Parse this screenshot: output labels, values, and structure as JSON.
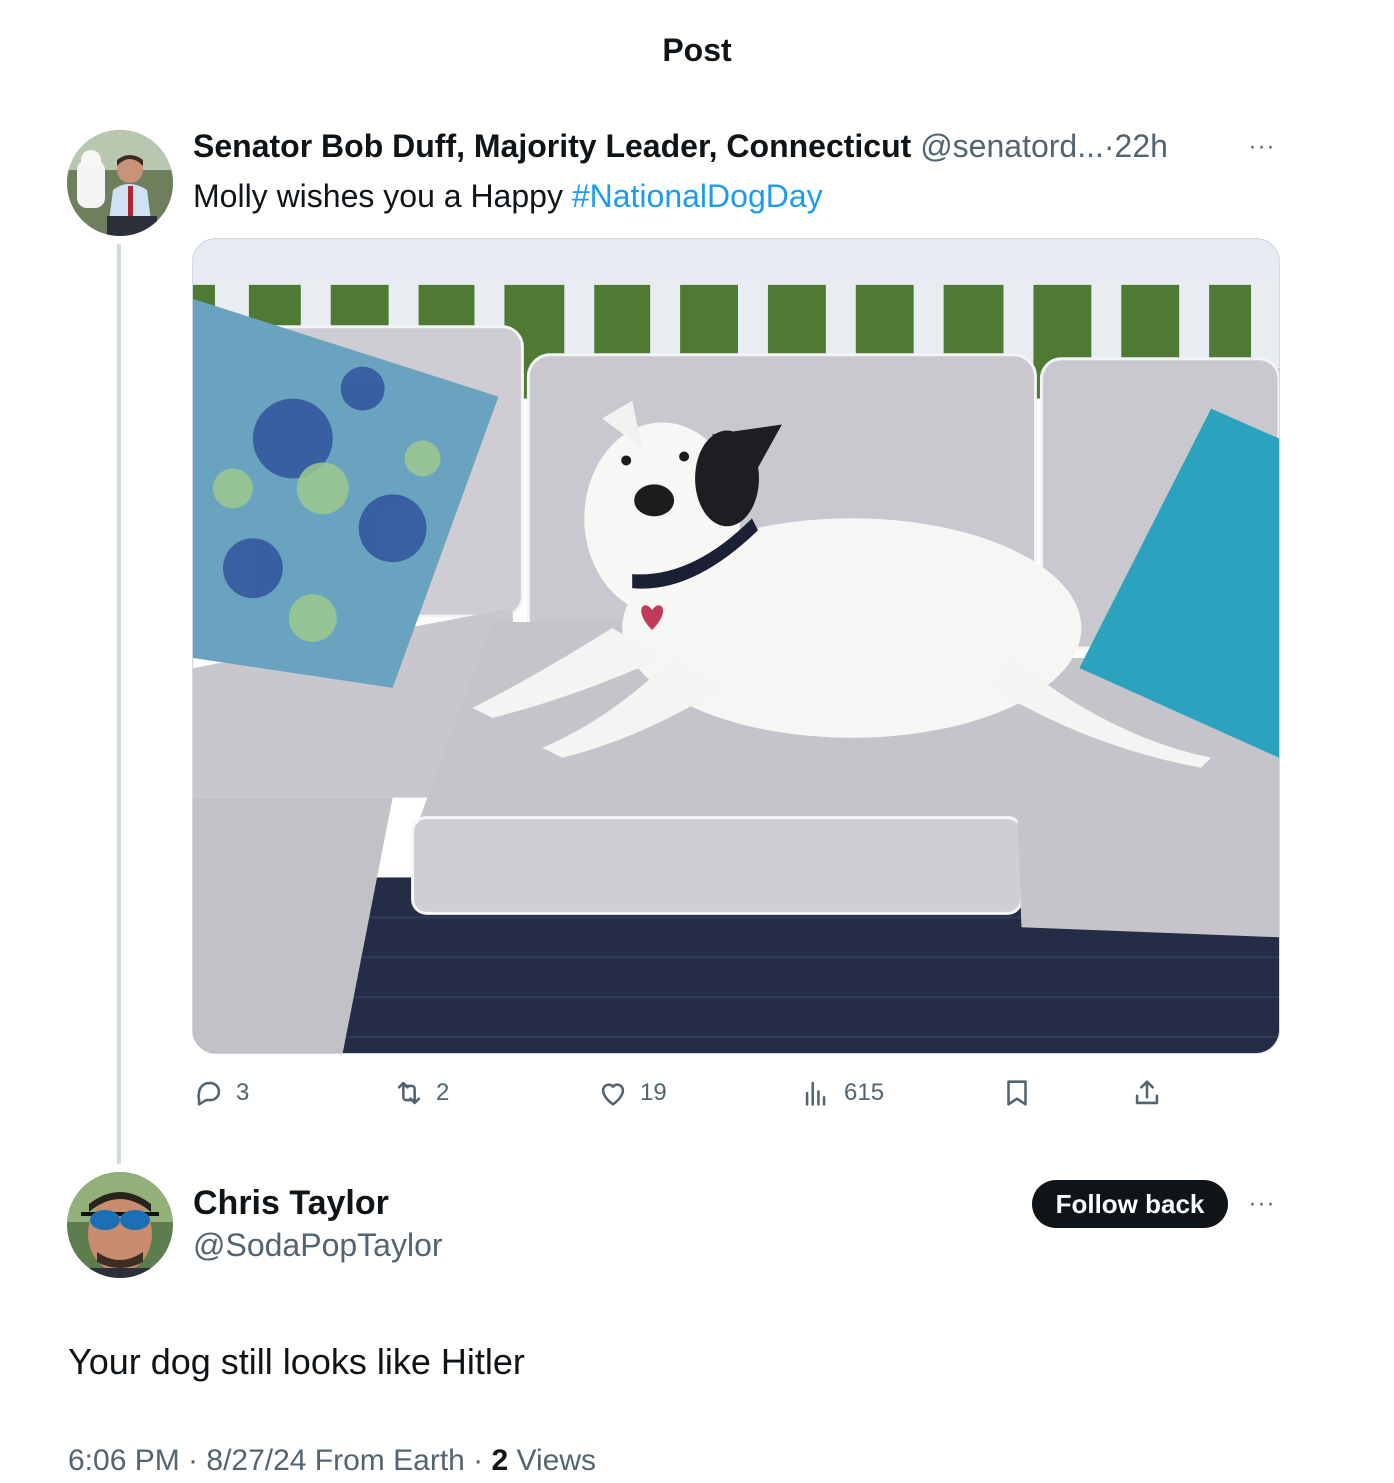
{
  "header": {
    "title": "Post"
  },
  "post": {
    "author_name": "Senator Bob Duff, Majority Leader, Connecticut",
    "author_handle": "@senatord...",
    "separator": "·",
    "time": "22h",
    "more_label": "···",
    "text_prefix": "Molly wishes you a Happy ",
    "hashtag": "#NationalDogDay",
    "stats": {
      "replies": "3",
      "reposts": "2",
      "likes": "19",
      "views": "615"
    }
  },
  "reply": {
    "author_name": "Chris Taylor",
    "author_handle": "@SodaPopTaylor",
    "follow_label": "Follow back",
    "more_label": "···",
    "text": "Your dog still looks like Hitler",
    "meta_prefix": "6:06 PM · 8/27/24 From Earth · ",
    "views_count": "2",
    "views_label": " Views"
  },
  "colors": {
    "accent": "#1d9bf0",
    "text_primary": "#0f1419",
    "text_secondary": "#536471",
    "divider": "#cfd9de"
  },
  "icons": {
    "reply": "speech-bubble-icon",
    "repost": "repost-arrows-icon",
    "like": "heart-icon",
    "views": "bar-chart-icon",
    "bookmark": "bookmark-icon",
    "share": "share-upload-icon"
  }
}
